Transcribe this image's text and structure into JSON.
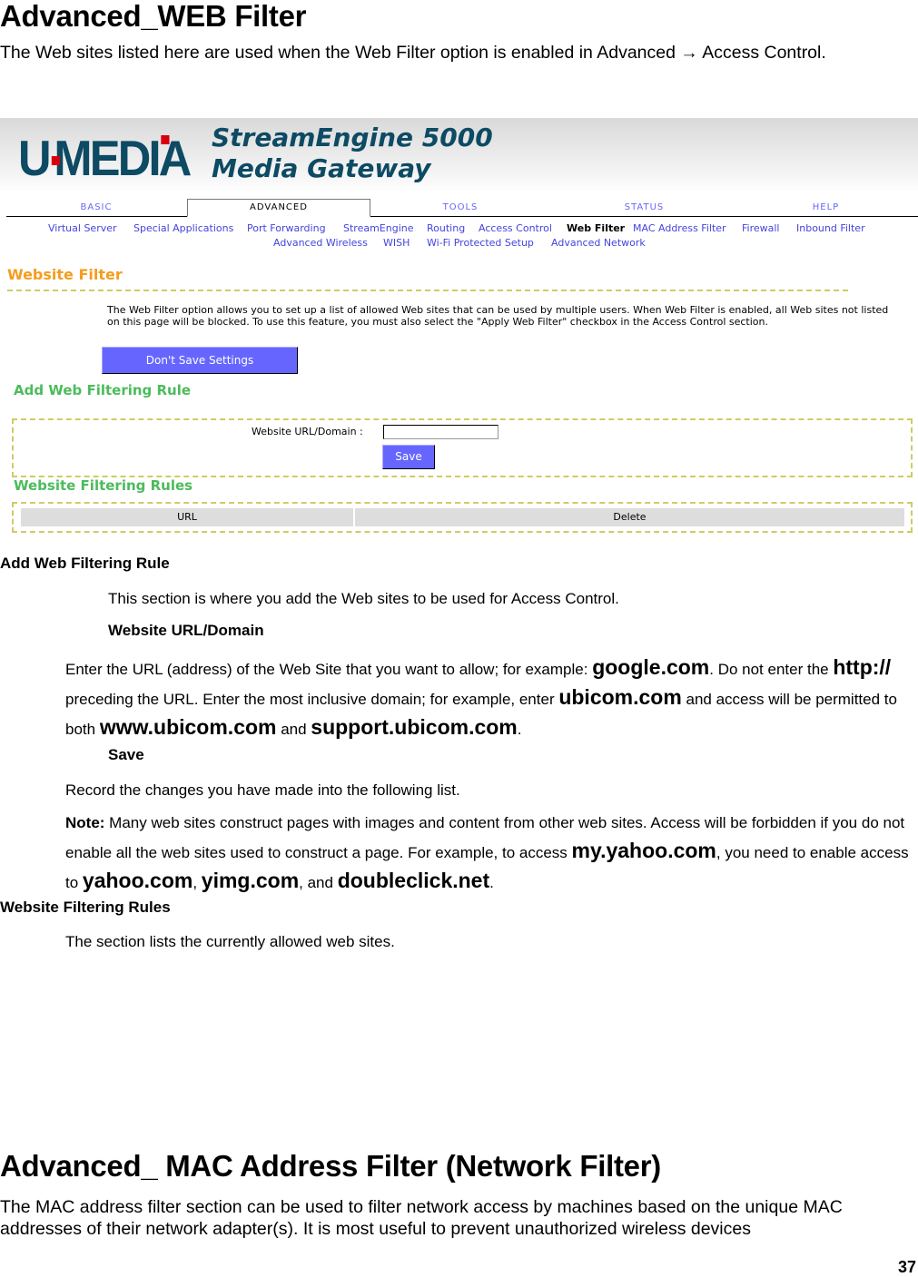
{
  "document": {
    "title": "Advanced_WEB Filter",
    "intro": "The Web sites listed here are used when the Web Filter option is enabled in Advanced → Access Control.",
    "sections": {
      "add_rule": {
        "heading": "Add Web Filtering Rule",
        "description": "This section is where you add the Web sites to be used for Access Control.",
        "url_field_heading": "Website URL/Domain",
        "url_text_1": "Enter the URL (address) of the Web Site that you want to allow; for example: ",
        "example_google": "google.com",
        "url_text_2": ". Do not enter the ",
        "example_http": "http://",
        "url_text_3": " preceding the URL. Enter the most inclusive domain; for example, enter ",
        "example_ubicom": "ubicom.com",
        "url_text_4": " and access will be permitted to both ",
        "example_www": "www.ubicom.com",
        "url_text_5": " and ",
        "example_support": "support.ubicom.com",
        "url_text_6": ".",
        "save_heading": "Save",
        "save_desc": "Record the changes you have made into the following list.",
        "note_label": "Note:",
        "note_text_1": " Many web sites construct pages with images and content from other web sites. Access will be forbidden if you do not enable all the web sites used to construct a page. For example, to access ",
        "example_myyahoo": "my.yahoo.com",
        "note_text_2": ", you need to enable access to ",
        "example_yahoo": "yahoo.com",
        "note_text_3": ", ",
        "example_yimg": "yimg.com",
        "note_text_4": ", and ",
        "example_doubleclick": "doubleclick.net",
        "note_text_5": "."
      },
      "rules": {
        "heading": "Website Filtering Rules",
        "description": "The section lists the currently allowed web sites."
      }
    },
    "next_title": "Advanced_ MAC Address Filter (Network Filter)",
    "next_intro": "The MAC address filter section can be used to filter network access by machines based on the unique MAC addresses of their network adapter(s). It is most useful to prevent unauthorized wireless devices",
    "page_number": "37"
  },
  "router_ui": {
    "brand": "U·MEDIA",
    "product_line1": "StreamEngine 5000",
    "product_line2": "Media Gateway",
    "colors": {
      "brand": "#0d4a63",
      "accent_red": "#d6000f",
      "button": "#6666ff",
      "title_orange": "#f59d1d",
      "title_green": "#4cbb5c",
      "dash": "#cccc66"
    },
    "tabs": [
      {
        "label": "BASIC",
        "active": false
      },
      {
        "label": "ADVANCED",
        "active": true
      },
      {
        "label": "TOOLS",
        "active": false
      },
      {
        "label": "STATUS",
        "active": false
      },
      {
        "label": "HELP",
        "active": false
      }
    ],
    "subnav": [
      {
        "label": "Virtual Server"
      },
      {
        "label": "Special Applications"
      },
      {
        "label": "Port Forwarding"
      },
      {
        "label": "StreamEngine"
      },
      {
        "label": "Routing"
      },
      {
        "label": "Access Control"
      },
      {
        "label": "Web Filter",
        "active": true
      },
      {
        "label": "MAC Address Filter"
      },
      {
        "label": "Firewall"
      },
      {
        "label": "Inbound Filter"
      },
      {
        "label": "Advanced Wireless"
      },
      {
        "label": "WISH"
      },
      {
        "label": "Wi-Fi Protected Setup"
      },
      {
        "label": "Advanced Network"
      }
    ],
    "page_title": "Website Filter",
    "intro_line1": "The Web Filter option allows you to set up a list of allowed Web sites that can be used by multiple users. When Web Filter is enabled, all Web sites not listed",
    "intro_line2": "on this page will be blocked. To use this feature, you must also select the \"Apply Web Filter\" checkbox in the Access Control section.",
    "dont_save_label": "Don't Save Settings",
    "add_rule_title": "Add Web Filtering Rule",
    "url_label": "Website URL/Domain :",
    "url_value": "",
    "save_label": "Save",
    "rules_title": "Website Filtering Rules",
    "table_headers": [
      "URL",
      "Delete"
    ]
  }
}
